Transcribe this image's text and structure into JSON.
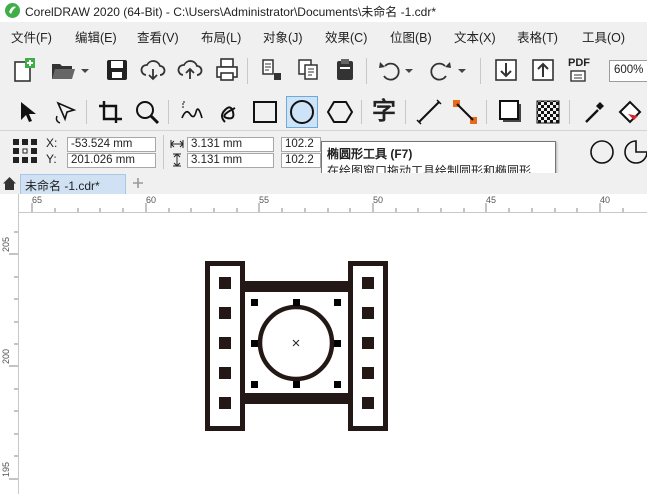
{
  "window": {
    "title": "CorelDRAW 2020 (64-Bit) - C:\\Users\\Administrator\\Documents\\未命名 -1.cdr*"
  },
  "menu": [
    {
      "label": "文件(F)"
    },
    {
      "label": "编辑(E)"
    },
    {
      "label": "查看(V)"
    },
    {
      "label": "布局(L)"
    },
    {
      "label": "对象(J)"
    },
    {
      "label": "效果(C)"
    },
    {
      "label": "位图(B)"
    },
    {
      "label": "文本(X)"
    },
    {
      "label": "表格(T)"
    },
    {
      "label": "工具(O)"
    }
  ],
  "toolbar": {
    "zoom": "600%",
    "pdf_label": "PDF"
  },
  "toolbox": {
    "text_tool_glyph": "字",
    "active_tool": "ellipse-tool"
  },
  "properties": {
    "x_label": "X:",
    "y_label": "Y:",
    "x_value": "-53.524 mm",
    "y_value": "201.026 mm",
    "width_value": "3.131 mm",
    "height_value": "3.131 mm",
    "scale_x": "102.2",
    "scale_y": "102.2"
  },
  "tooltip": {
    "title": "椭圆形工具 (F7)",
    "description": "在绘图窗口拖动工具绘制圆形和椭圆形."
  },
  "document": {
    "tab_label": "未命名 -1.cdr*"
  },
  "rulers": {
    "horizontal": [
      "65",
      "60",
      "55",
      "50",
      "45",
      "40"
    ],
    "vertical": [
      "205",
      "200",
      "195"
    ]
  },
  "colors": {
    "menu_bg": "#f0f0f0",
    "active_tool_bg": "#cde3f7",
    "tab_bg": "#cfe1f3",
    "brand_green": "#3fae49",
    "film_color": "#231815"
  }
}
